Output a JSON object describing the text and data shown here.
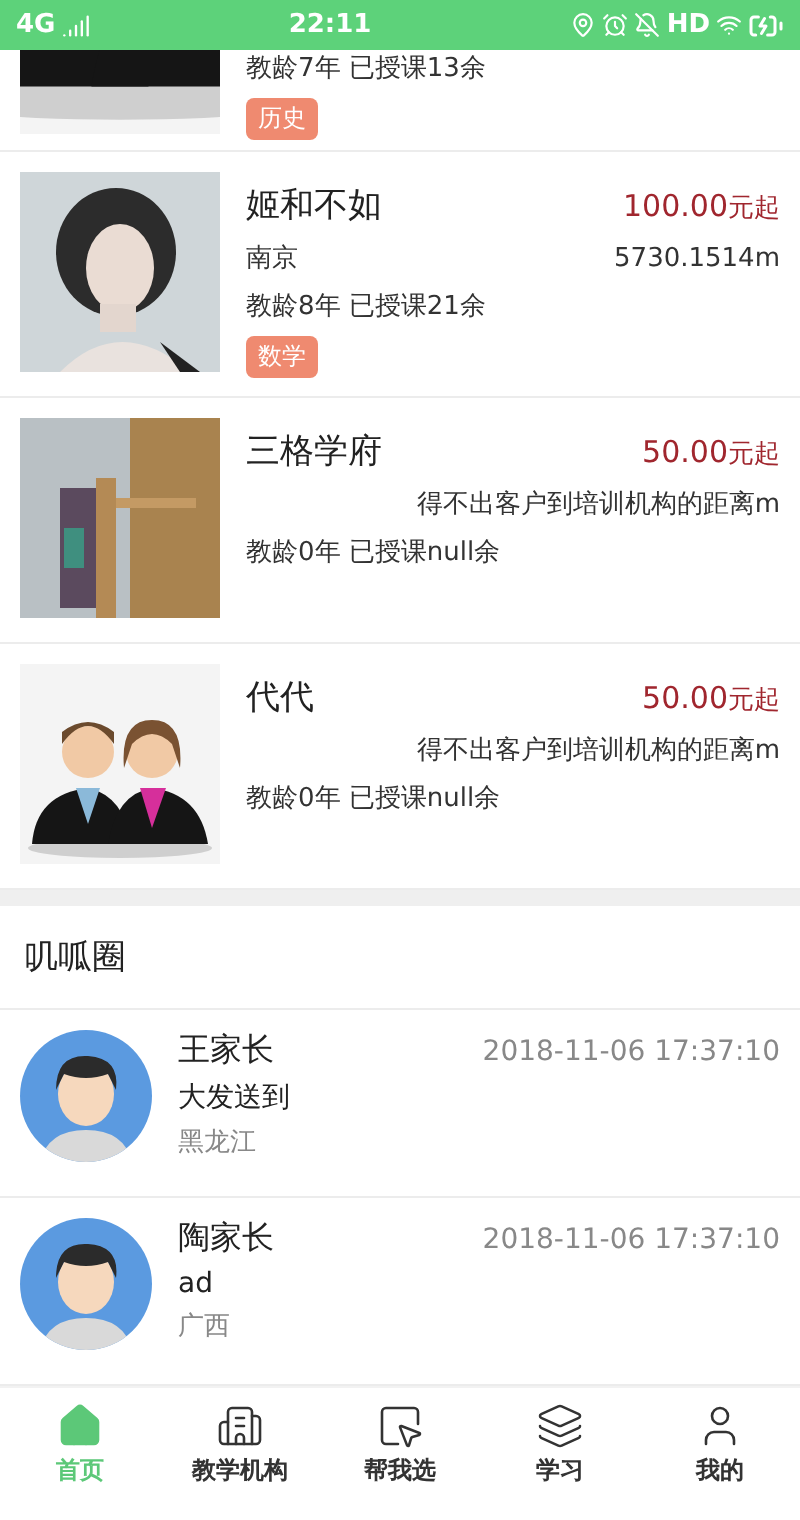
{
  "status_bar": {
    "network": "4G",
    "time": "22:11",
    "hd": "HD"
  },
  "institutions": [
    {
      "stats": "教龄7年  已授课13余",
      "tag": "历史"
    },
    {
      "name": "姬和不如",
      "price": "100.00",
      "price_unit": "元起",
      "location": "南京",
      "distance": "5730.1514m",
      "stats": "教龄8年  已授课21余",
      "tag": "数学"
    },
    {
      "name": "三格学府",
      "price": "50.00",
      "price_unit": "元起",
      "distance": "得不出客户到培训机构的距离m",
      "stats": "教龄0年  已授课null余"
    },
    {
      "name": "代代",
      "price": "50.00",
      "price_unit": "元起",
      "distance": "得不出客户到培训机构的距离m",
      "stats": "教龄0年  已授课null余"
    }
  ],
  "feed": {
    "title": "叽呱圈",
    "posts": [
      {
        "author": "王家长",
        "time": "2018-11-06 17:37:10",
        "content": "大发送到",
        "location": "黑龙江"
      },
      {
        "author": "陶家长",
        "time": "2018-11-06 17:37:10",
        "content": "ad",
        "location": "广西"
      }
    ]
  },
  "tab_bar": [
    {
      "label": "首页",
      "selected": true
    },
    {
      "label": "教学机构",
      "selected": false
    },
    {
      "label": "帮我选",
      "selected": false
    },
    {
      "label": "学习",
      "selected": false
    },
    {
      "label": "我的",
      "selected": false
    }
  ]
}
